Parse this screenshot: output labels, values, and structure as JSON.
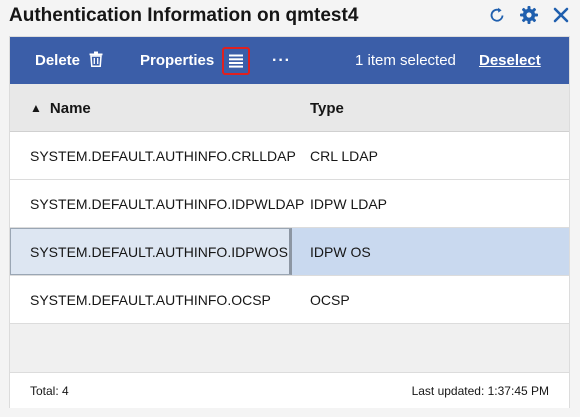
{
  "header": {
    "title": "Authentication Information on qmtest4",
    "refresh_icon": "refresh-icon",
    "settings_icon": "gear-icon",
    "close_icon": "close-icon"
  },
  "toolbar": {
    "delete_label": "Delete",
    "delete_icon": "trash-icon",
    "properties_label": "Properties",
    "properties_icon": "list-icon",
    "more_label": "···",
    "selected_text": "1 item selected",
    "deselect_label": "Deselect",
    "color": "#3b5ea8"
  },
  "table": {
    "sort_indicator": "▲",
    "columns": {
      "name": "Name",
      "type": "Type"
    },
    "rows": [
      {
        "name": "SYSTEM.DEFAULT.AUTHINFO.CRLLDAP",
        "type": "CRL LDAP"
      },
      {
        "name": "SYSTEM.DEFAULT.AUTHINFO.IDPWLDAP",
        "type": "IDPW LDAP"
      },
      {
        "name": "SYSTEM.DEFAULT.AUTHINFO.IDPWOS",
        "type": "IDPW OS"
      },
      {
        "name": "SYSTEM.DEFAULT.AUTHINFO.OCSP",
        "type": "OCSP"
      }
    ],
    "selected_row": "SYSTEM.DEFAULT.AUTHINFO.IDPWOS",
    "selected_color": "#c9d9ef"
  },
  "footer": {
    "total": "Total: 4",
    "last_updated": "Last updated: 1:37:45 PM"
  }
}
